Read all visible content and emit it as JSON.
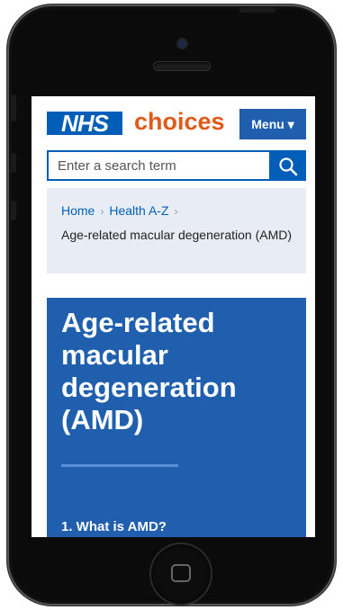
{
  "header": {
    "nhs_logo": "NHS",
    "site_name": "choices",
    "menu_label": "Menu ▾"
  },
  "search": {
    "placeholder": "Enter a search term",
    "icon": "search-icon"
  },
  "breadcrumb": {
    "items": [
      "Home",
      "Health A-Z"
    ],
    "separator": "›",
    "current": "Age-related macular degeneration (AMD)"
  },
  "page": {
    "title": "Age-related macular degeneration (AMD)",
    "toc": [
      {
        "label": "1.  What is AMD?"
      }
    ]
  },
  "colors": {
    "nhs_blue": "#005eb8",
    "hero_blue": "#1f5fad",
    "choices_orange": "#e05b1a",
    "breadcrumb_bg": "#e8edf5"
  }
}
